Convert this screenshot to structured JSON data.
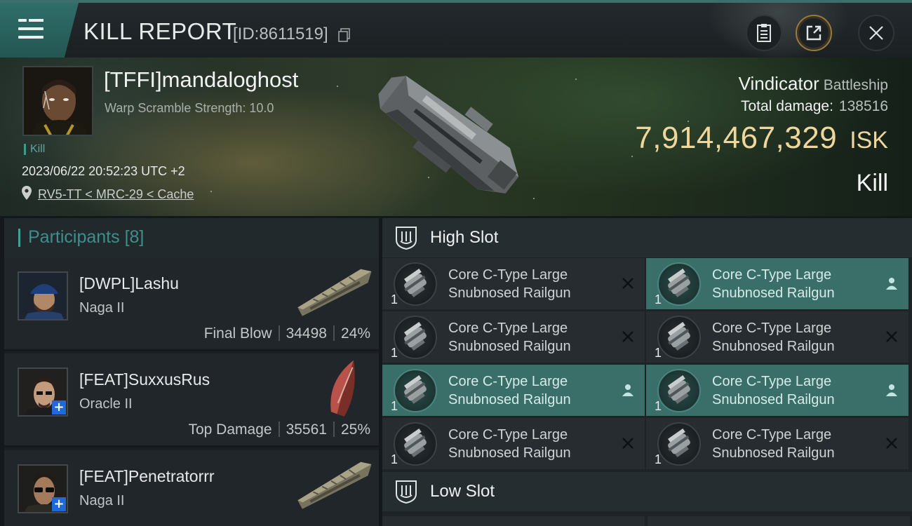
{
  "header": {
    "title": "KILL REPORT",
    "report_id": "[ID:8611519]"
  },
  "victim": {
    "name": "[TFFI]mandaloghost",
    "warp_scramble": "Warp Scramble Strength: 10.0",
    "tag": "Kill",
    "timestamp": "2023/06/22 20:52:23 UTC +2",
    "location": "RV5-TT < MRC-29 < Cache",
    "ship_name": "Vindicator",
    "ship_class": "Battleship",
    "total_damage_label": "Total damage:",
    "total_damage": "138516",
    "isk_value": "7,914,467,329",
    "isk_unit": "ISK",
    "result": "Kill"
  },
  "participants": {
    "label": "Participants",
    "count": "[8]",
    "items": [
      {
        "name": "[DWPL]Lashu",
        "ship": "Naga II",
        "role": "Final Blow",
        "damage": "34498",
        "percent": "24%"
      },
      {
        "name": "[FEAT]SuxxusRus",
        "ship": "Oracle II",
        "role": "Top Damage",
        "damage": "35561",
        "percent": "25%"
      },
      {
        "name": "[FEAT]Penetratorrr",
        "ship": "Naga II",
        "role": "",
        "damage": "",
        "percent": ""
      }
    ]
  },
  "slots": {
    "high_label": "High Slot",
    "low_label": "Low Slot",
    "modules": [
      {
        "name_line1": "Core C-Type Large",
        "name_line2": "Snubnosed Railgun",
        "qty": "1",
        "state": "destroyed"
      },
      {
        "name_line1": "Core C-Type Large",
        "name_line2": "Snubnosed Railgun",
        "qty": "1",
        "state": "dropped"
      },
      {
        "name_line1": "Core C-Type Large",
        "name_line2": "Snubnosed Railgun",
        "qty": "1",
        "state": "destroyed"
      },
      {
        "name_line1": "Core C-Type Large",
        "name_line2": "Snubnosed Railgun",
        "qty": "1",
        "state": "destroyed"
      },
      {
        "name_line1": "Core C-Type Large",
        "name_line2": "Snubnosed Railgun",
        "qty": "1",
        "state": "dropped"
      },
      {
        "name_line1": "Core C-Type Large",
        "name_line2": "Snubnosed Railgun",
        "qty": "1",
        "state": "dropped"
      },
      {
        "name_line1": "Core C-Type Large",
        "name_line2": "Snubnosed Railgun",
        "qty": "1",
        "state": "destroyed"
      },
      {
        "name_line1": "Core C-Type Large",
        "name_line2": "Snubnosed Railgun",
        "qty": "1",
        "state": "destroyed"
      }
    ]
  },
  "colors": {
    "accent_teal": "#3fa19b",
    "isk_gold": "#efd79c",
    "fitted_bg": "#3a6e69"
  },
  "icons": [
    "menu-icon",
    "copy-icon",
    "clipboard-icon",
    "share-icon",
    "close-icon",
    "location-pin-icon",
    "high-slot-icon",
    "low-slot-icon",
    "railgun-icon",
    "destroyed-icon",
    "dropped-icon"
  ]
}
